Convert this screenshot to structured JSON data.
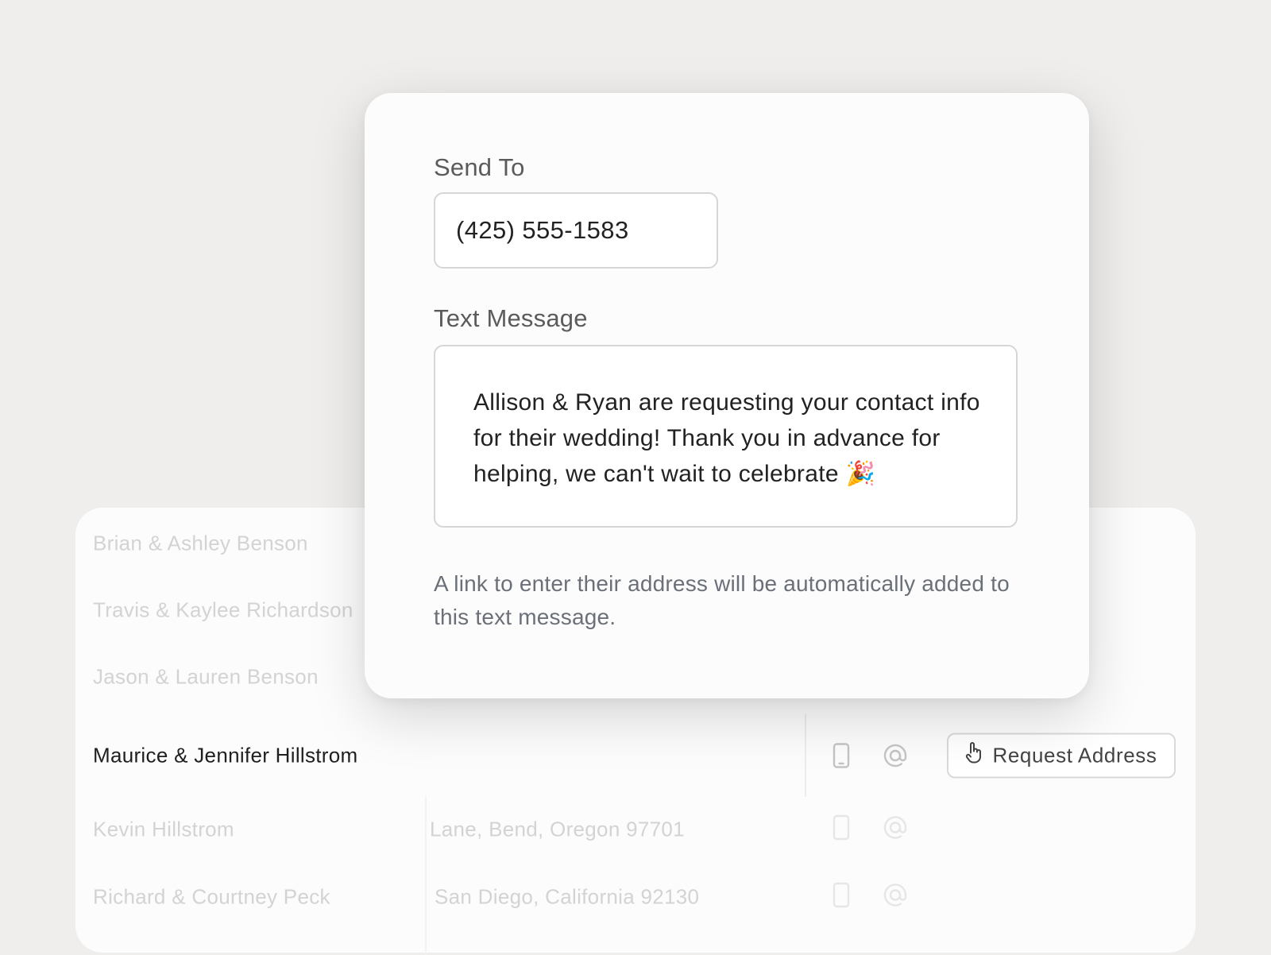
{
  "guest_list": {
    "rows": [
      {
        "name": "Brian & Ashley Benson"
      },
      {
        "name": "Travis & Kaylee Richardson"
      },
      {
        "name": "Jason & Lauren Benson"
      },
      {
        "name": "Maurice & Jennifer Hillstrom"
      },
      {
        "name": "Kevin Hillstrom",
        "address": "Lane, Bend, Oregon 97701"
      },
      {
        "name": "Richard & Courtney Peck",
        "address": "San Diego, California 92130"
      }
    ],
    "active_row_icons": [
      "phone-icon",
      "at-sign-icon",
      "hand-pointer-icon"
    ],
    "request_button_label": "Request Address"
  },
  "modal": {
    "send_to_label": "Send To",
    "send_to_value": "(425) 555-1583",
    "text_message_label": "Text Message",
    "message_body": "Allison & Ryan are requesting your contact info for their wedding! Thank you in advance for helping, we can't wait to celebrate 🎉",
    "help_text": "A link to enter their address will be automatically added to this text message."
  }
}
